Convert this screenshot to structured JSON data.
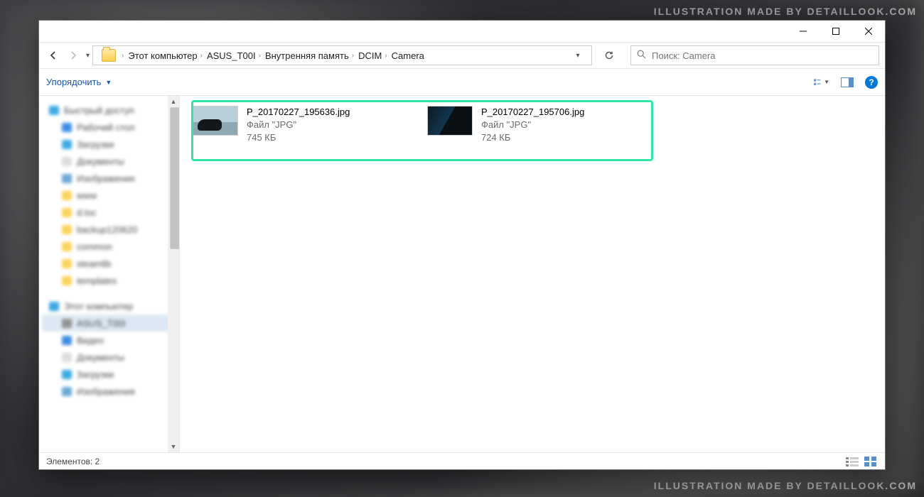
{
  "watermark_top": "ILLUSTRATION MADE BY DETAILLOOK.COM",
  "watermark_bottom": "ILLUSTRATION MADE BY DETAILLOOK.COM",
  "breadcrumb": [
    "Этот компьютер",
    "ASUS_T00I",
    "Внутренняя память",
    "DCIM",
    "Camera"
  ],
  "search": {
    "placeholder": "Поиск: Camera"
  },
  "commandbar": {
    "organize": "Упорядочить"
  },
  "nav": {
    "items": [
      {
        "label": "Быстрый доступ",
        "color": "#2aa0e0"
      },
      {
        "label": "Рабочий стол",
        "color": "#2a7fe0"
      },
      {
        "label": "Загрузки",
        "color": "#2aa0e0"
      },
      {
        "label": "Документы",
        "color": "#d9d9d9"
      },
      {
        "label": "Изображения",
        "color": "#5aa0d0"
      },
      {
        "label": "www",
        "color": "#fccf4d"
      },
      {
        "label": "d.loc",
        "color": "#fccf4d"
      },
      {
        "label": "backup120620",
        "color": "#fccf4d"
      },
      {
        "label": "common",
        "color": "#fccf4d"
      },
      {
        "label": "steamlib",
        "color": "#fccf4d"
      },
      {
        "label": "templates",
        "color": "#fccf4d"
      }
    ],
    "items2": [
      {
        "label": "Этот компьютер",
        "color": "#2aa0e0"
      },
      {
        "label": "ASUS_T00I",
        "color": "#888",
        "selected": true
      },
      {
        "label": "Видео",
        "color": "#2a7fe0"
      },
      {
        "label": "Документы",
        "color": "#d9d9d9"
      },
      {
        "label": "Загрузки",
        "color": "#2aa0e0"
      },
      {
        "label": "Изображения",
        "color": "#5aa0d0"
      }
    ]
  },
  "files": [
    {
      "name": "P_20170227_195636.jpg",
      "type": "Файл \"JPG\"",
      "size": "745 КБ",
      "thumb": "a"
    },
    {
      "name": "P_20170227_195706.jpg",
      "type": "Файл \"JPG\"",
      "size": "724 КБ",
      "thumb": "b"
    }
  ],
  "status": {
    "count_label": "Элементов: 2"
  }
}
